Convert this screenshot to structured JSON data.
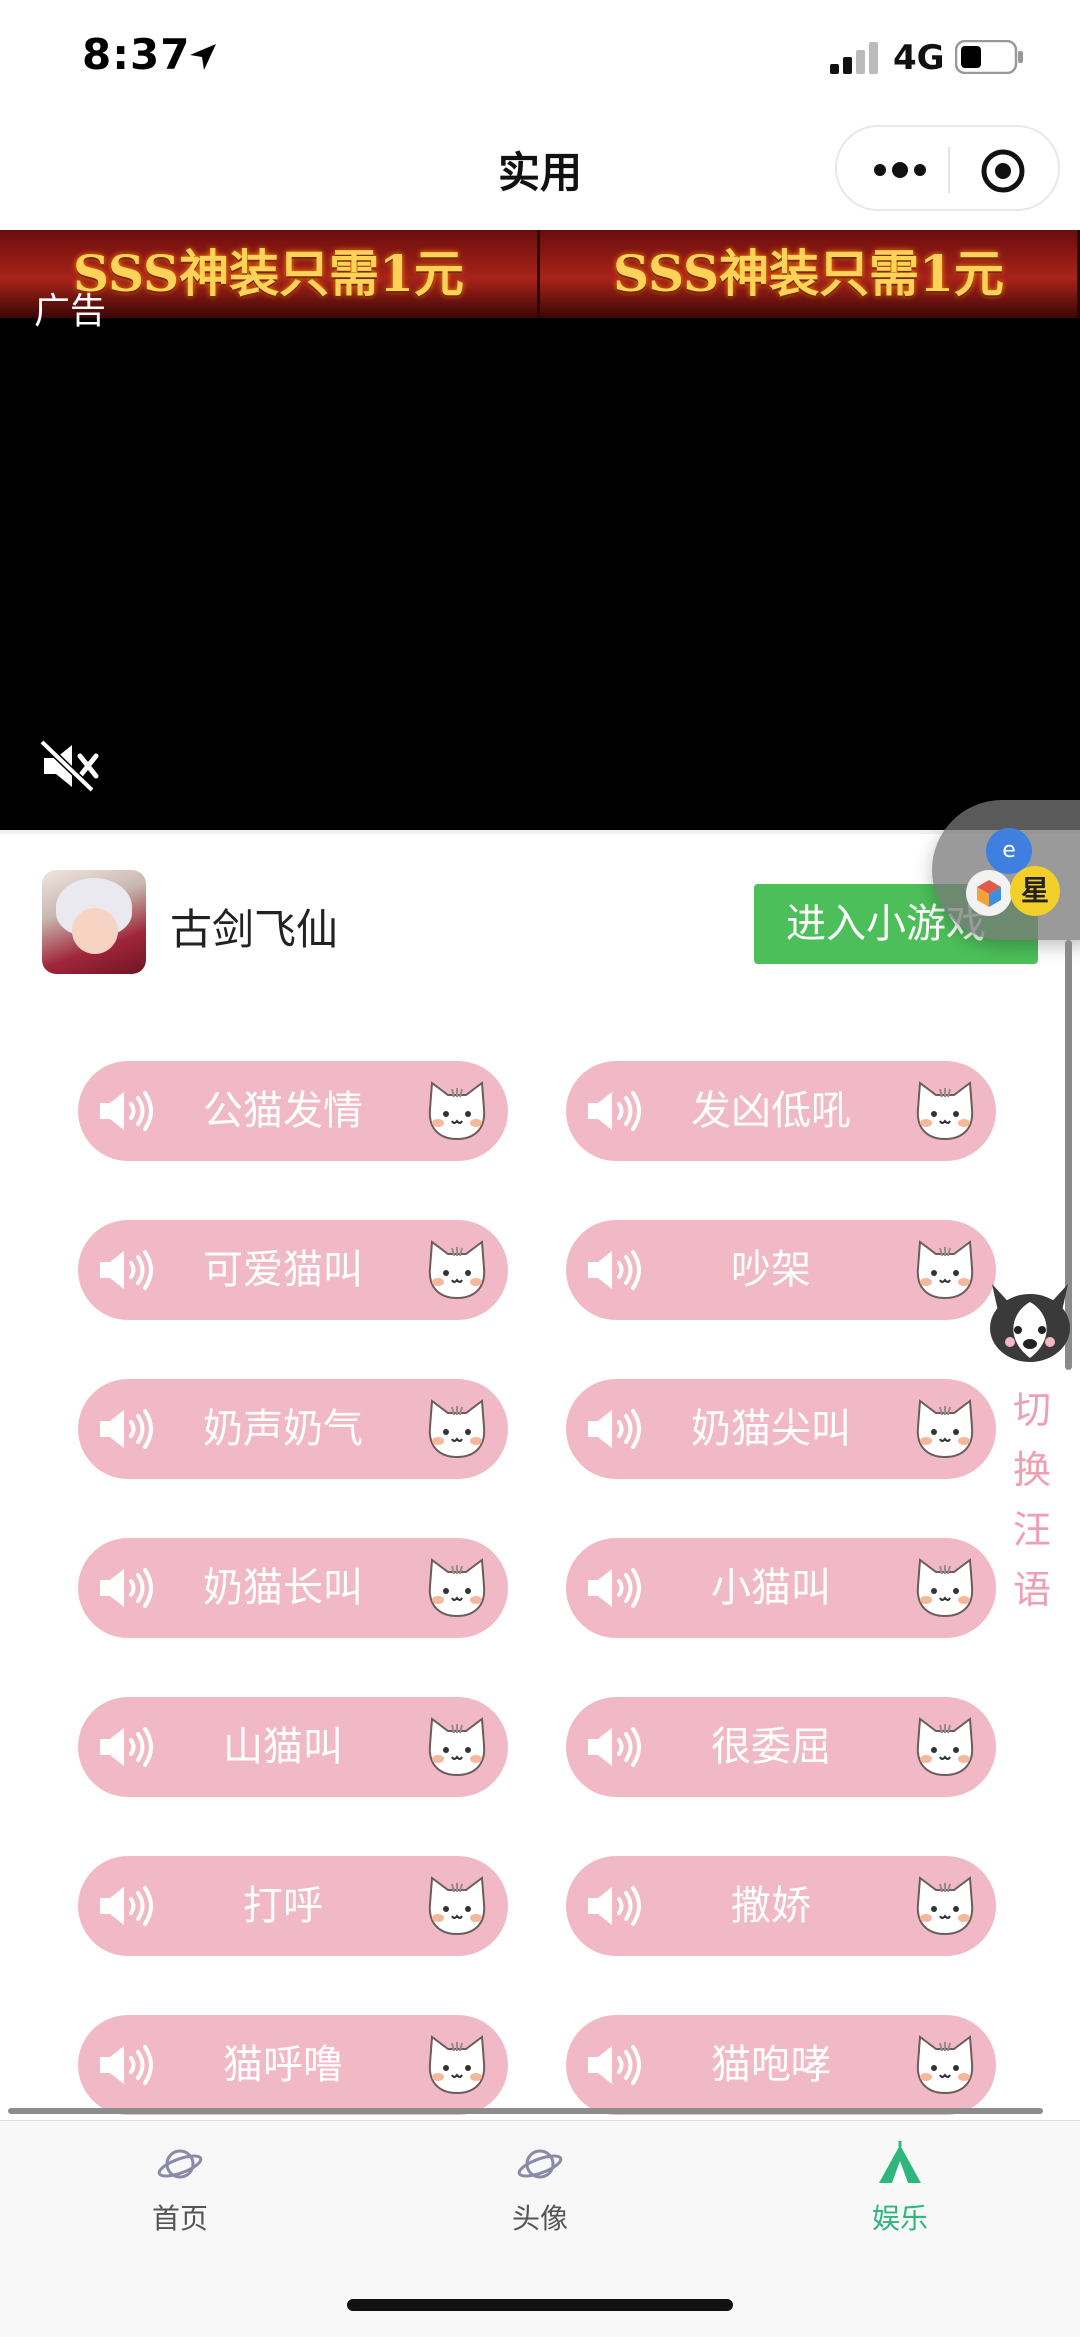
{
  "status_bar": {
    "time": "8:37",
    "network": "4G"
  },
  "nav": {
    "title": "实用"
  },
  "ad": {
    "banner_text": "SSS神装只需1元",
    "label": "广告"
  },
  "game": {
    "name": "古剑飞仙",
    "button": "进入小游戏"
  },
  "float_widget": {
    "badge": "星"
  },
  "sounds": [
    "公猫发情",
    "发凶低吼",
    "可爱猫叫",
    "吵架",
    "奶声奶气",
    "奶猫尖叫",
    "奶猫长叫",
    "小猫叫",
    "山猫叫",
    "很委屈",
    "打呼",
    "撒娇",
    "猫呼噜",
    "猫咆哮"
  ],
  "side_switch": {
    "text": "切换汪语"
  },
  "tabs": [
    {
      "label": "首页",
      "icon": "planet-icon",
      "active": false
    },
    {
      "label": "头像",
      "icon": "planet-icon",
      "active": false
    },
    {
      "label": "娱乐",
      "icon": "tent-icon",
      "active": true
    }
  ],
  "colors": {
    "accent": "#2fb67c",
    "sound_button": "#f1b9c6",
    "switch_text": "#ee9fb2",
    "enter_button": "#4cbf5a"
  }
}
